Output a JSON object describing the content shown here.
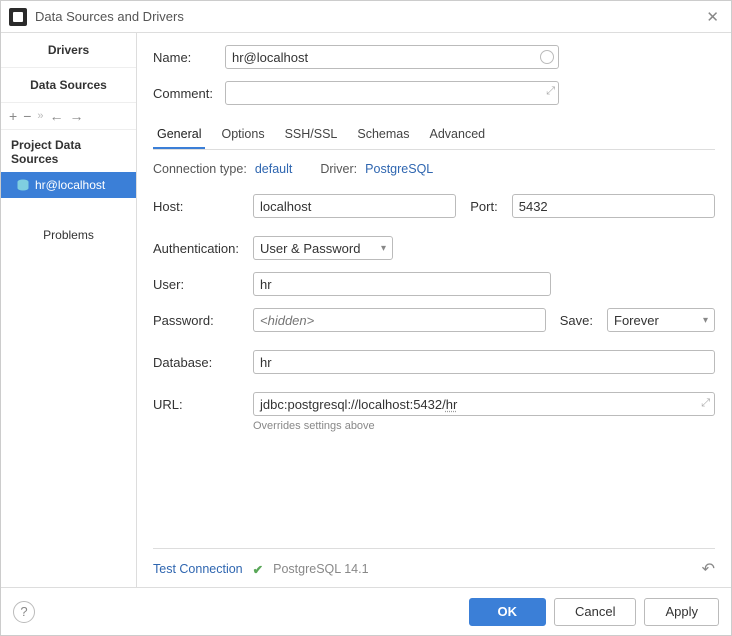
{
  "window": {
    "title": "Data Sources and Drivers"
  },
  "sidebar": {
    "sections": [
      "Drivers",
      "Data Sources"
    ],
    "toolbar_icons": [
      "plus-icon",
      "minus-icon",
      "more-icon",
      "back-icon",
      "forward-icon"
    ],
    "header": "Project Data Sources",
    "items": [
      {
        "label": "hr@localhost",
        "selected": true
      }
    ],
    "problems_label": "Problems"
  },
  "form": {
    "name_label": "Name:",
    "name_value": "hr@localhost",
    "comment_label": "Comment:",
    "comment_value": ""
  },
  "tabs": [
    "General",
    "Options",
    "SSH/SSL",
    "Schemas",
    "Advanced"
  ],
  "active_tab": "General",
  "connection": {
    "type_label": "Connection type:",
    "type_value": "default",
    "driver_label": "Driver:",
    "driver_value": "PostgreSQL"
  },
  "fields": {
    "host_label": "Host:",
    "host_value": "localhost",
    "port_label": "Port:",
    "port_value": "5432",
    "auth_label": "Authentication:",
    "auth_value": "User & Password",
    "user_label": "User:",
    "user_value": "hr",
    "password_label": "Password:",
    "password_placeholder": "<hidden>",
    "save_label": "Save:",
    "save_value": "Forever",
    "database_label": "Database:",
    "database_value": "hr",
    "url_label": "URL:",
    "url_prefix": "jdbc:postgresql://localhost:5432/",
    "url_db": "hr",
    "url_hint": "Overrides settings above"
  },
  "status": {
    "test_label": "Test Connection",
    "check_mark": "✔",
    "status_text": "PostgreSQL 14.1"
  },
  "footer": {
    "ok": "OK",
    "cancel": "Cancel",
    "apply": "Apply"
  }
}
